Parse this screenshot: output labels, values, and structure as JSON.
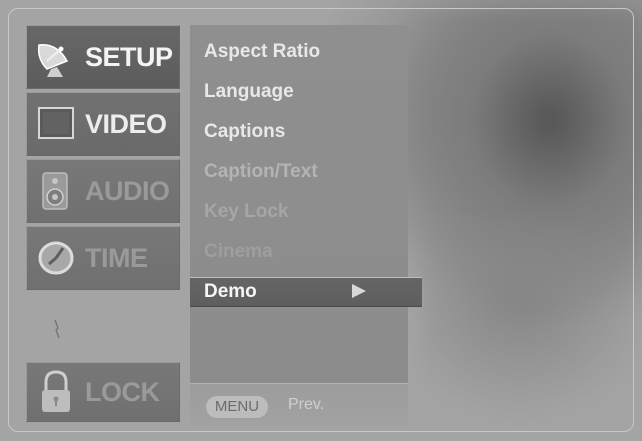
{
  "categories": [
    {
      "id": "setup",
      "label": "SETUP",
      "icon": "satellite-dish-icon",
      "state": "active"
    },
    {
      "id": "video",
      "label": "VIDEO",
      "icon": "screen-icon",
      "state": "normal"
    },
    {
      "id": "audio",
      "label": "AUDIO",
      "icon": "speaker-icon",
      "state": "dim"
    },
    {
      "id": "time",
      "label": "TIME",
      "icon": "clock-icon",
      "state": "dim"
    },
    {
      "id": "lock",
      "label": "LOCK",
      "icon": "padlock-icon",
      "state": "dim"
    }
  ],
  "items": [
    {
      "label": "Aspect Ratio"
    },
    {
      "label": "Language"
    },
    {
      "label": "Captions"
    },
    {
      "label": "Caption/Text"
    },
    {
      "label": "Key Lock"
    },
    {
      "label": "Cinema"
    },
    {
      "label": "Demo"
    }
  ],
  "selected_item": "Demo",
  "footer": {
    "menu_button": "MENU",
    "prev_label": "Prev."
  }
}
